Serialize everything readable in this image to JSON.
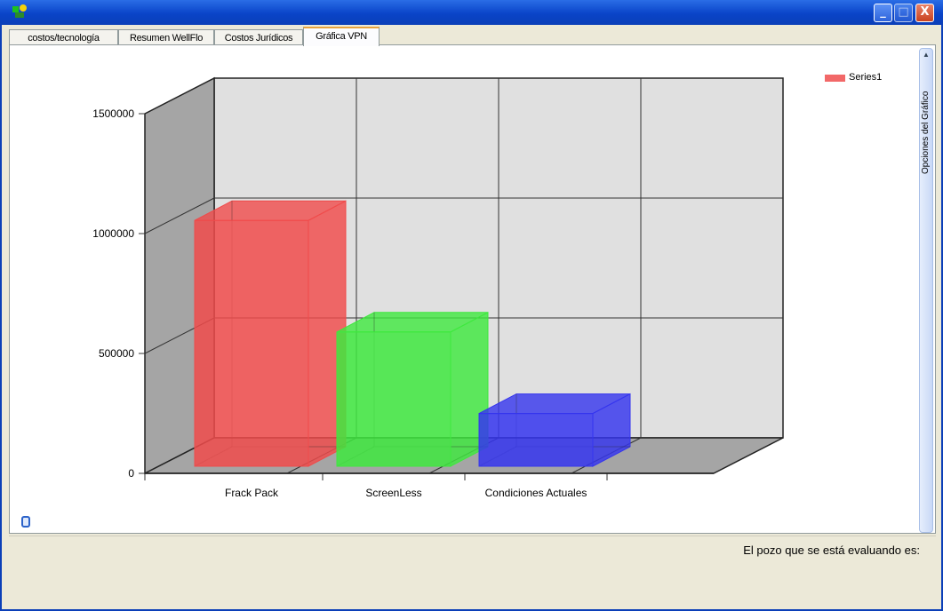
{
  "window": {
    "min_label": "_",
    "max_label": "□",
    "close_label": "X"
  },
  "tabs": [
    {
      "label": "costos/tecnología",
      "active": false
    },
    {
      "label": "Resumen WellFlo",
      "active": false
    },
    {
      "label": "Costos Jurídicos",
      "active": false
    },
    {
      "label": "Gráfica VPN",
      "active": true
    }
  ],
  "side_panel": {
    "label": "Opciones del Gráfico"
  },
  "status": {
    "text": "El pozo que se está evaluando es:"
  },
  "chart_data": {
    "type": "bar",
    "three_d": true,
    "categories": [
      "Frack Pack",
      "ScreenLess",
      "Condiciones Actuales"
    ],
    "series": [
      {
        "name": "Series1",
        "values": [
          1025000,
          560000,
          220000
        ],
        "colors": [
          "#f04b4b",
          "#3ee83e",
          "#3535ee"
        ]
      }
    ],
    "ylim": [
      0,
      1500000
    ],
    "yticks": [
      0,
      500000,
      1000000,
      1500000
    ],
    "ytick_labels": [
      "0",
      "500000",
      "1000000",
      "1500000"
    ],
    "grid": true,
    "legend": "top-right",
    "legend_color": "#f26868"
  }
}
